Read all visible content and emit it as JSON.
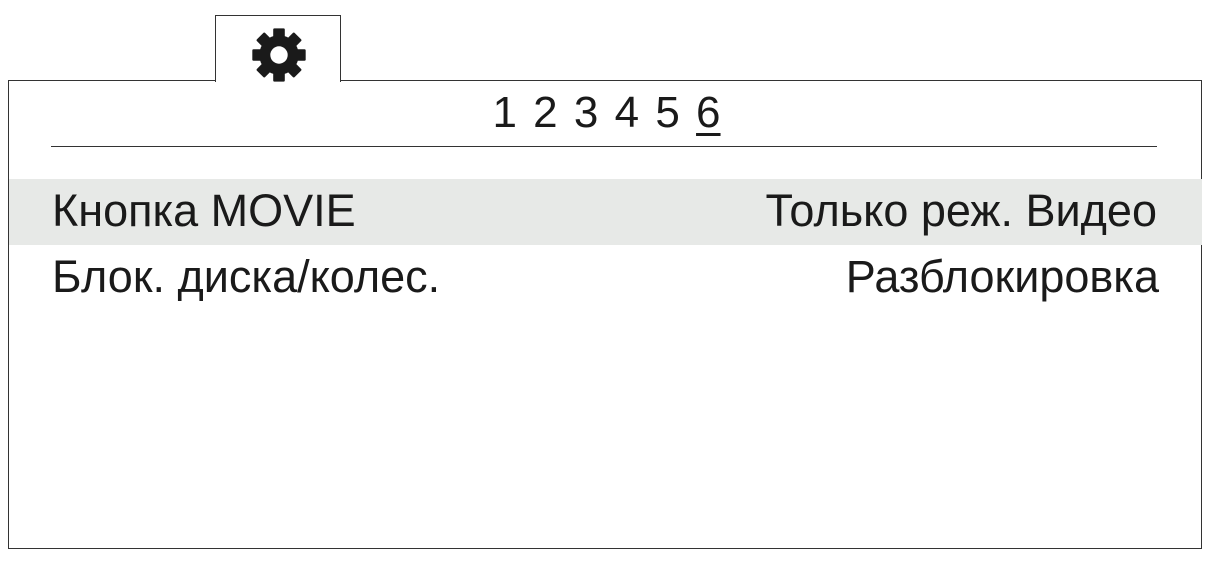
{
  "tabs": [
    {
      "icon": "gear-icon",
      "active": true
    }
  ],
  "page_indicator": {
    "pages": [
      "1",
      "2",
      "3",
      "4",
      "5",
      "6"
    ],
    "current": "6"
  },
  "menu": {
    "items": [
      {
        "label": "Кнопка MOVIE",
        "value": "Только реж. Видео",
        "selected": true
      },
      {
        "label": "Блок. диска/колес.",
        "value": "Разблокировка",
        "selected": false
      }
    ]
  },
  "colors": {
    "border": "#333333",
    "selected_row": "#e7e9e7",
    "text": "#1a1a1a"
  }
}
